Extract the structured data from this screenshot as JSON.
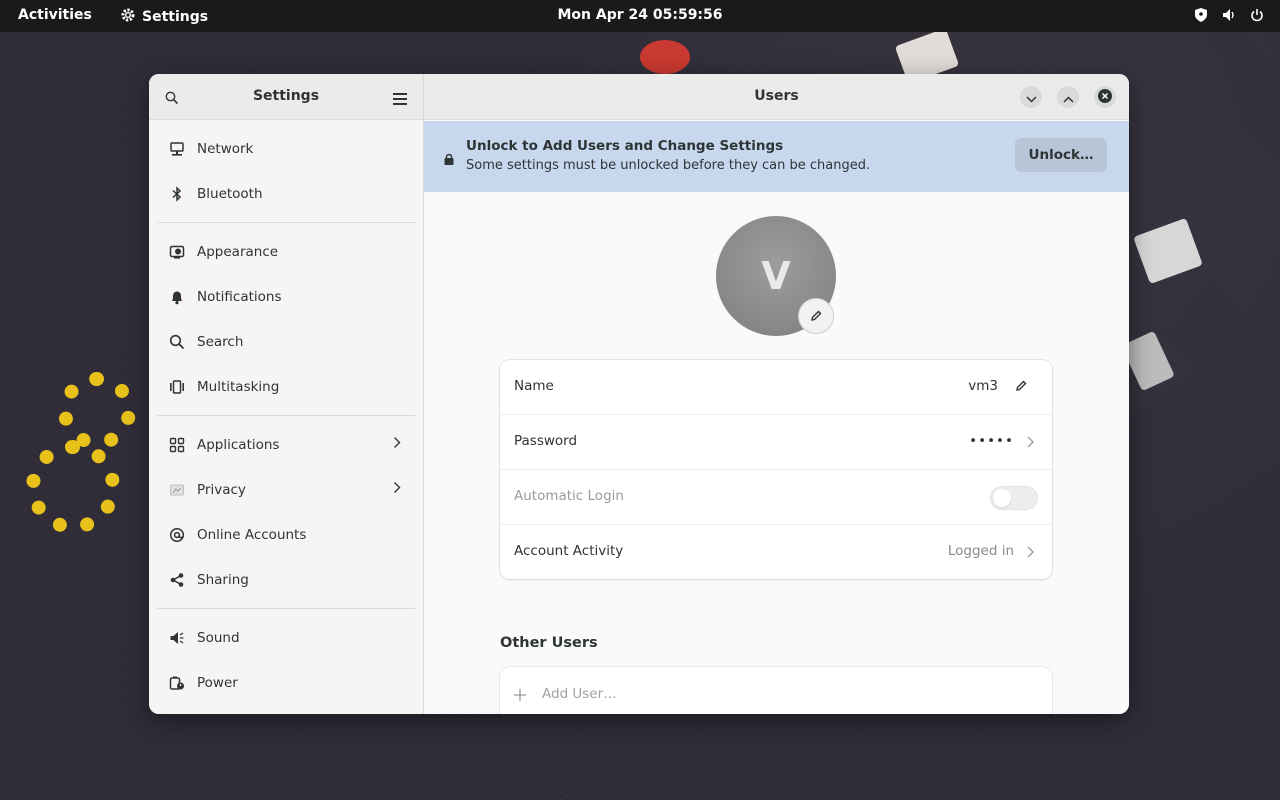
{
  "topbar": {
    "activities": "Activities",
    "app_name": "Settings",
    "clock": "Mon Apr 24  05:59:56"
  },
  "sidebar": {
    "title": "Settings",
    "items": [
      {
        "label": "Network",
        "icon": "network-icon"
      },
      {
        "label": "Bluetooth",
        "icon": "bluetooth-icon"
      },
      {
        "label": "Appearance",
        "icon": "appearance-icon"
      },
      {
        "label": "Notifications",
        "icon": "bell-icon"
      },
      {
        "label": "Search",
        "icon": "search-icon"
      },
      {
        "label": "Multitasking",
        "icon": "multitasking-icon"
      },
      {
        "label": "Applications",
        "icon": "apps-grid-icon"
      },
      {
        "label": "Privacy",
        "icon": "privacy-icon"
      },
      {
        "label": "Online Accounts",
        "icon": "at-icon"
      },
      {
        "label": "Sharing",
        "icon": "share-icon"
      },
      {
        "label": "Sound",
        "icon": "speaker-icon"
      },
      {
        "label": "Power",
        "icon": "power-battery-icon"
      }
    ]
  },
  "main": {
    "title": "Users",
    "banner": {
      "title": "Unlock to Add Users and Change Settings",
      "subtitle": "Some settings must be unlocked before they can be changed.",
      "button": "Unlock…"
    },
    "avatar_letter": "V",
    "rows": {
      "name_label": "Name",
      "name_value": "vm3",
      "password_label": "Password",
      "password_value": "•••••",
      "autologin_label": "Automatic Login",
      "activity_label": "Account Activity",
      "activity_value": "Logged in"
    },
    "other_users_title": "Other Users",
    "add_user_label": "Add User…"
  }
}
